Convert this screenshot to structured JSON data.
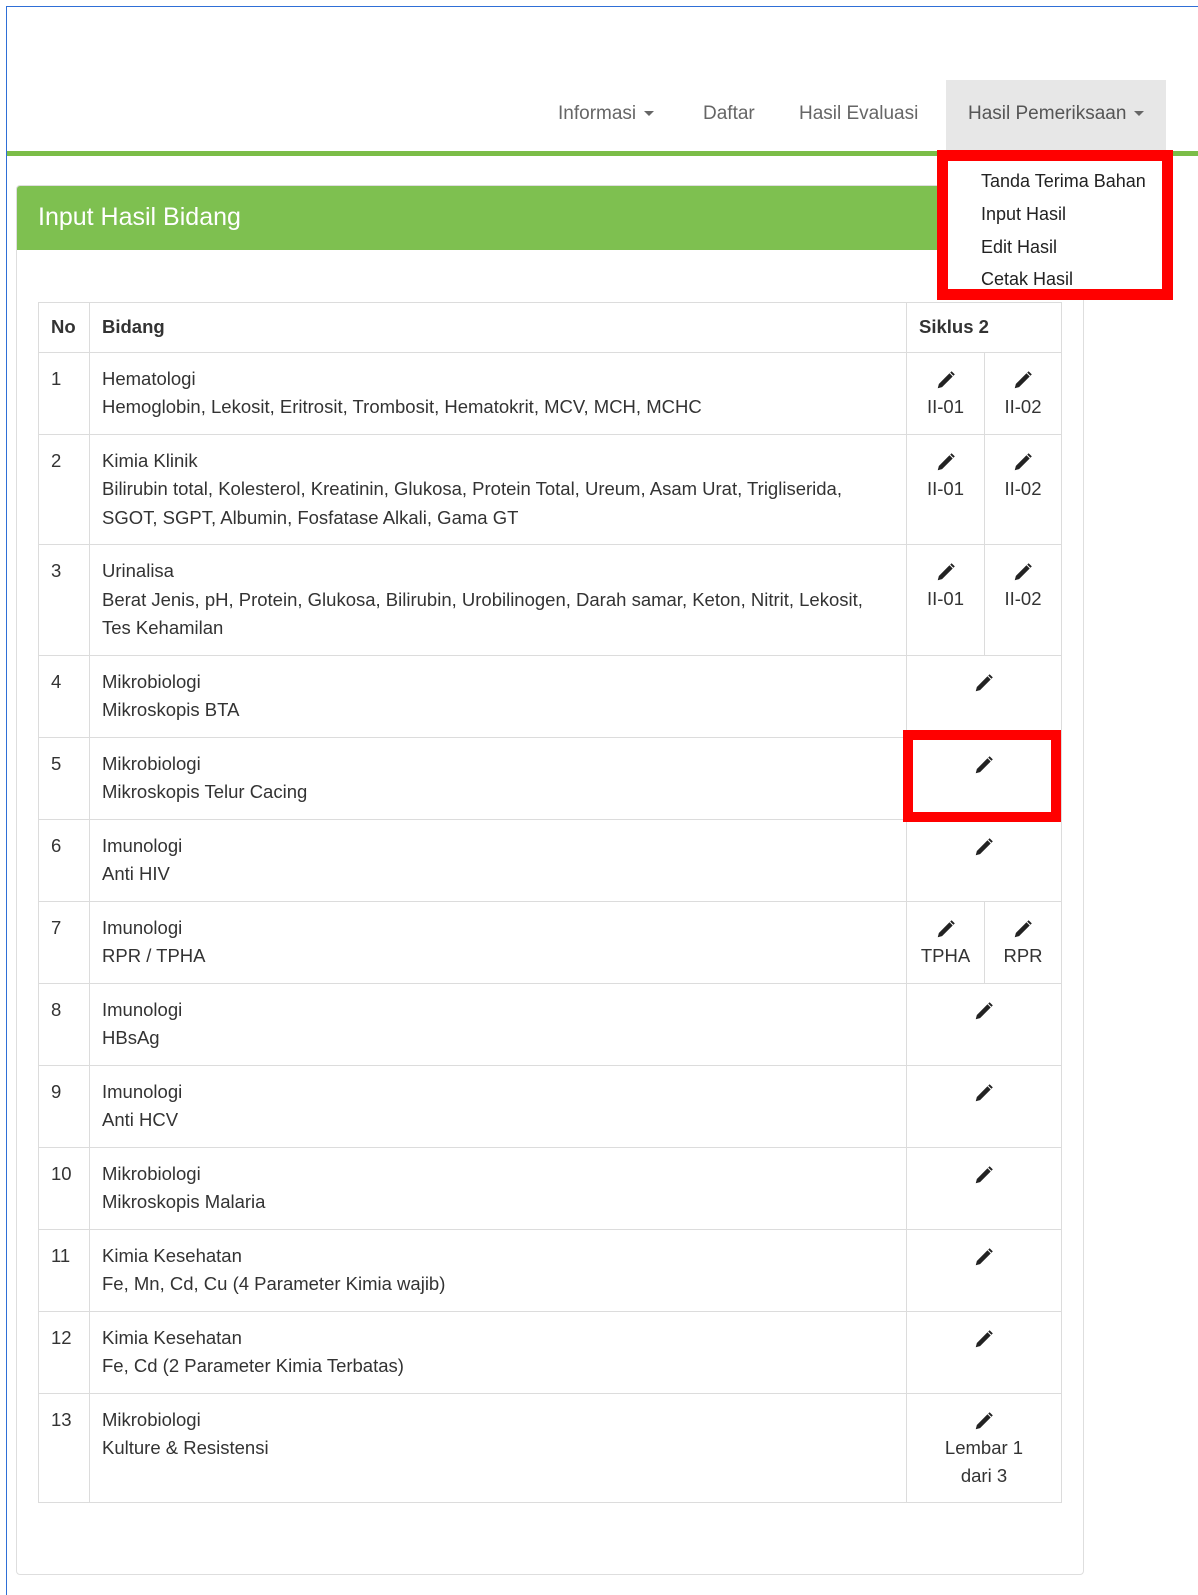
{
  "nav": {
    "items": [
      {
        "label": "Informasi",
        "has_caret": true
      },
      {
        "label": "Daftar",
        "has_caret": false
      },
      {
        "label": "Hasil Evaluasi",
        "has_caret": false
      },
      {
        "label": "Hasil Pemeriksaan",
        "has_caret": true,
        "active": true
      }
    ],
    "dropdown": [
      "Tanda Terima Bahan",
      "Input Hasil",
      "Edit Hasil",
      "Cetak Hasil"
    ]
  },
  "panel": {
    "title": "Input Hasil Bidang"
  },
  "table": {
    "headers": {
      "no": "No",
      "bidang": "Bidang",
      "siklus": "Siklus 2"
    },
    "rows": [
      {
        "no": "1",
        "name": "Hematologi",
        "params": "Hemoglobin, Lekosit, Eritrosit, Trombosit, Hematokrit, MCV, MCH, MCHC",
        "actions": [
          "II-01",
          "II-02"
        ]
      },
      {
        "no": "2",
        "name": "Kimia Klinik",
        "params": "Bilirubin total, Kolesterol, Kreatinin, Glukosa, Protein Total, Ureum, Asam Urat, Trigliserida, SGOT, SGPT, Albumin, Fosfatase Alkali, Gama GT",
        "actions": [
          "II-01",
          "II-02"
        ]
      },
      {
        "no": "3",
        "name": "Urinalisa",
        "params": "Berat Jenis, pH, Protein, Glukosa, Bilirubin, Urobilinogen, Darah samar, Keton, Nitrit, Lekosit, Tes Kehamilan",
        "actions": [
          "II-01",
          "II-02"
        ]
      },
      {
        "no": "4",
        "name": "Mikrobiologi",
        "params": "Mikroskopis BTA",
        "actions": []
      },
      {
        "no": "5",
        "name": "Mikrobiologi",
        "params": "Mikroskopis Telur Cacing",
        "actions": []
      },
      {
        "no": "6",
        "name": "Imunologi",
        "params": "Anti HIV",
        "actions": []
      },
      {
        "no": "7",
        "name": "Imunologi",
        "params": "RPR / TPHA",
        "actions": [
          "TPHA",
          "RPR"
        ]
      },
      {
        "no": "8",
        "name": "Imunologi",
        "params": "HBsAg",
        "actions": []
      },
      {
        "no": "9",
        "name": "Imunologi",
        "params": "Anti HCV",
        "actions": []
      },
      {
        "no": "10",
        "name": "Mikrobiologi",
        "params": "Mikroskopis Malaria",
        "actions": []
      },
      {
        "no": "11",
        "name": "Kimia Kesehatan",
        "params": "Fe, Mn, Cd, Cu (4 Parameter Kimia wajib)",
        "actions": []
      },
      {
        "no": "12",
        "name": "Kimia Kesehatan",
        "params": "Fe, Cd (2 Parameter Kimia Terbatas)",
        "actions": []
      },
      {
        "no": "13",
        "name": "Mikrobiologi",
        "params": "Kulture & Resistensi",
        "actions": [],
        "single_label": "Lembar 1 dari 3"
      }
    ]
  },
  "colors": {
    "accent_green": "#7ec050",
    "highlight_red": "#ff0000",
    "frame_blue": "#2f6fd6"
  },
  "icons": {
    "edit": "pencil-icon",
    "dropdown": "caret-down-icon"
  }
}
